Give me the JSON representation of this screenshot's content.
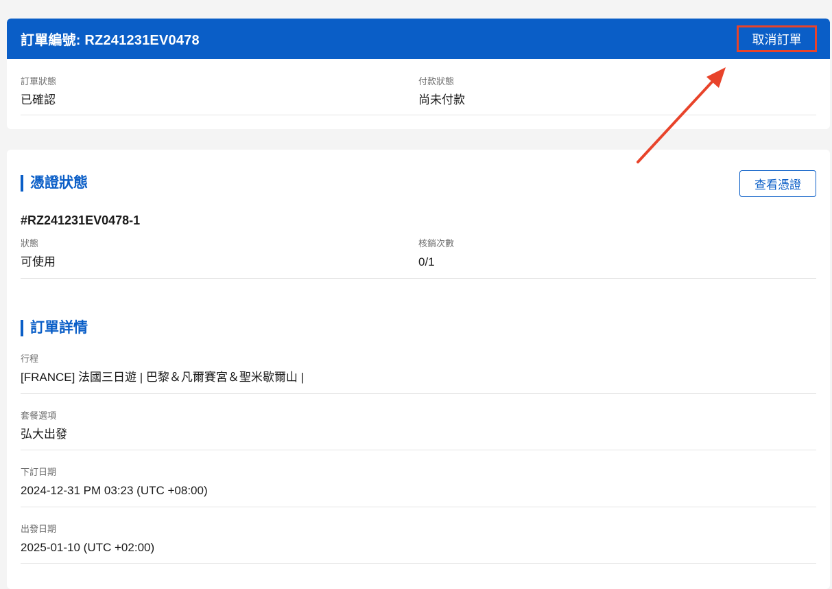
{
  "order": {
    "title": "訂單編號: RZ241231EV0478",
    "cancel_label": "取消訂單",
    "status_label": "訂單狀態",
    "status_value": "已確認",
    "payment_label": "付款狀態",
    "payment_value": "尚未付款"
  },
  "voucher": {
    "section_title": "憑證狀態",
    "view_label": "查看憑證",
    "id": "#RZ241231EV0478-1",
    "state_label": "狀態",
    "state_value": "可使用",
    "redeem_label": "核銷次數",
    "redeem_value": "0/1"
  },
  "details": {
    "section_title": "訂單詳情",
    "items": [
      {
        "label": "行程",
        "value": "[FRANCE] 法國三日遊 | 巴黎＆凡爾賽宮＆聖米歇爾山 |"
      },
      {
        "label": "套餐選項",
        "value": "弘大出發"
      },
      {
        "label": "下訂日期",
        "value": "2024-12-31 PM 03:23 (UTC +08:00)"
      },
      {
        "label": "出發日期",
        "value": "2025-01-10 (UTC +02:00)"
      }
    ]
  },
  "colors": {
    "brand": "#0a5ec7",
    "highlight": "#e8432a"
  }
}
